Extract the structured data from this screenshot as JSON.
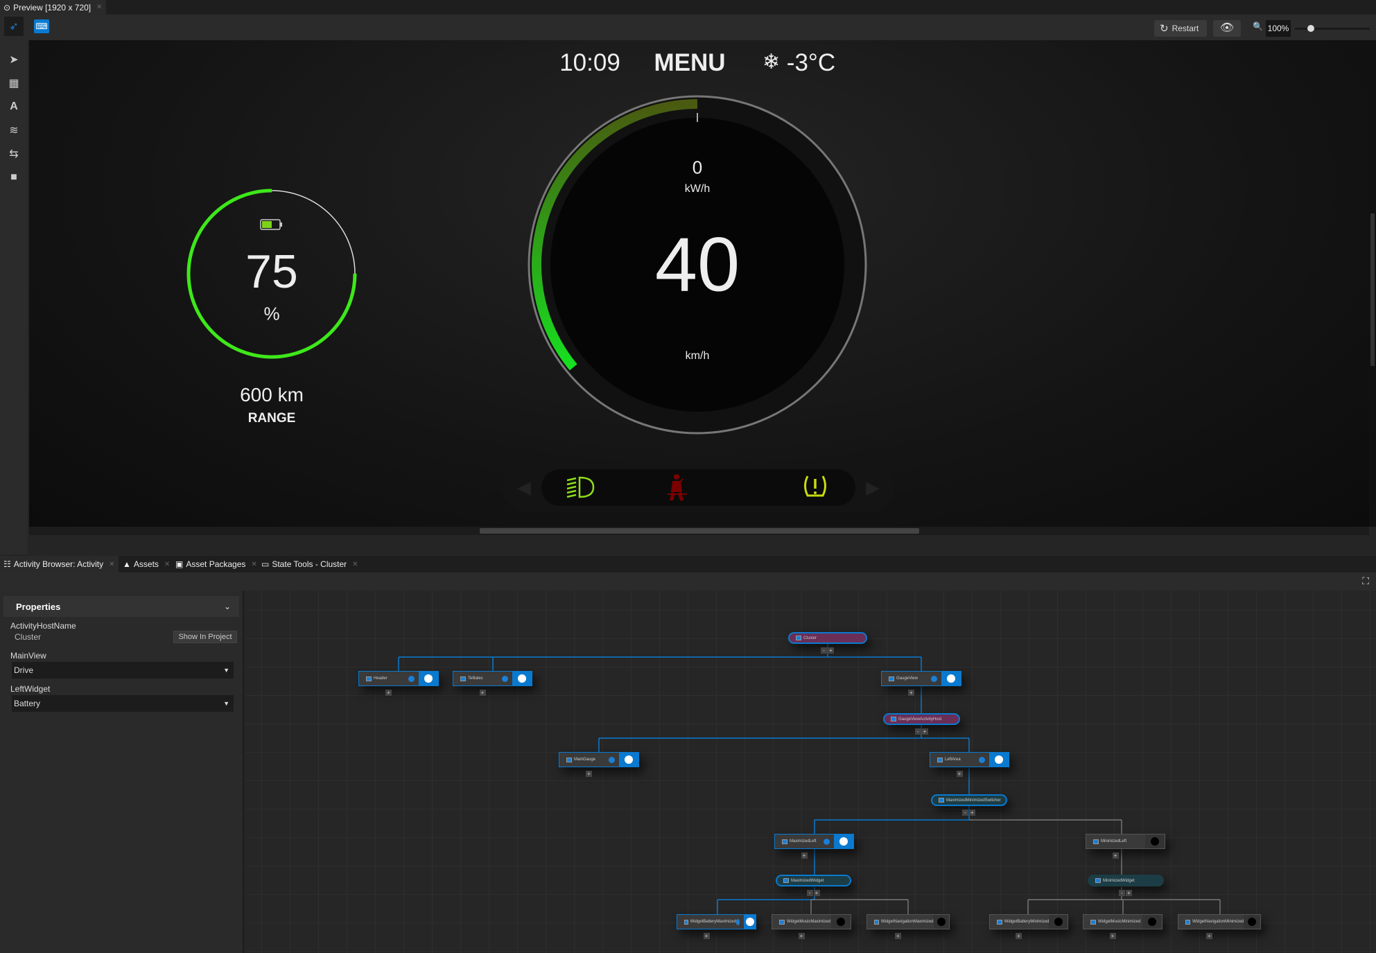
{
  "window": {
    "tab_title": "Preview [1920 x 720]"
  },
  "toolbar": {
    "restart_label": "Restart",
    "zoom_value": "100%",
    "zoom_slider_fraction": 0.2
  },
  "left_tools": [
    "interact-icon",
    "select-icon",
    "grid-icon",
    "text-layout-icon",
    "layers-icon",
    "bindings-icon",
    "camera-icon"
  ],
  "cluster": {
    "time": "10:09",
    "menu": "MENU",
    "temperature": "-3°C",
    "battery": {
      "percent_value": "75",
      "percent_unit": "%",
      "fill_fraction": 0.75,
      "range": "600 km",
      "range_label": "RANGE"
    },
    "power": {
      "value": "0",
      "unit": "kW/h"
    },
    "speed": {
      "value": "40",
      "unit": "km/h",
      "arc_fraction": 0.36
    },
    "telltales": [
      {
        "name": "headlight",
        "color": "#8fdc1e"
      },
      {
        "name": "seatbelt",
        "color": "#7a0000"
      },
      {
        "name": "tire-pressure",
        "color": "#c8dc10"
      }
    ],
    "colors": {
      "accent_green": "#3ee81a"
    }
  },
  "bottom_tabs": [
    {
      "label": "Activity Browser: Activity"
    },
    {
      "label": "Assets"
    },
    {
      "label": "Asset Packages"
    },
    {
      "label": "State Tools - Cluster"
    }
  ],
  "properties": {
    "title": "Properties",
    "activity_host_label": "ActivityHostName",
    "activity_host_value": "Cluster",
    "show_in_project": "Show In Project",
    "main_view_label": "MainView",
    "main_view_value": "Drive",
    "left_widget_label": "LeftWidget",
    "left_widget_value": "Battery"
  },
  "graph": {
    "nodes": [
      {
        "label": "Cluster",
        "kind": "host",
        "active": true
      },
      {
        "label": "Header",
        "kind": "activity",
        "active": true
      },
      {
        "label": "Telltales",
        "kind": "activity",
        "active": true
      },
      {
        "label": "GaugeView",
        "kind": "activity",
        "active": true
      },
      {
        "label": "GaugeViewActivityHost",
        "kind": "host",
        "active": true
      },
      {
        "label": "MainGauge",
        "kind": "activity",
        "active": true
      },
      {
        "label": "LeftArea",
        "kind": "activity",
        "active": true
      },
      {
        "label": "MaximizedMinimizedSwitcher",
        "kind": "switcher",
        "active": true
      },
      {
        "label": "MaximizedLeft",
        "kind": "activity",
        "active": true
      },
      {
        "label": "MinimizedLeft",
        "kind": "activity",
        "active": false
      },
      {
        "label": "MaximizedWidget",
        "kind": "switcher",
        "active": true
      },
      {
        "label": "MinimizedWidget",
        "kind": "switcher",
        "active": false
      },
      {
        "label": "WidgetBatteryMaximized",
        "kind": "activity",
        "active": true
      },
      {
        "label": "WidgetMusicMaximized",
        "kind": "activity",
        "active": false
      },
      {
        "label": "WidgetNavigationMaximized",
        "kind": "activity",
        "active": false
      },
      {
        "label": "WidgetBatteryMinimized",
        "kind": "activity",
        "active": false
      },
      {
        "label": "WidgetMusicMinimized",
        "kind": "activity",
        "active": false
      },
      {
        "label": "WidgetNavigationMinimized",
        "kind": "activity",
        "active": false
      }
    ]
  }
}
